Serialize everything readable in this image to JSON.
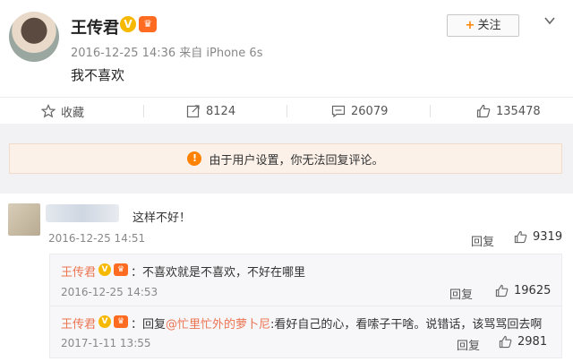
{
  "post": {
    "author": "王传君",
    "vip_badge": "V",
    "member_badge": "♛",
    "meta": "2016-12-25 14:36 来自 iPhone 6s",
    "content": "我不喜欢",
    "follow_label": "关注",
    "follow_plus": "+"
  },
  "actions": {
    "favorite_label": "收藏",
    "forward_count": "8124",
    "comment_count": "26079",
    "like_count": "135478"
  },
  "notice": {
    "text": "由于用户设置，你无法回复评论。",
    "icon": "!"
  },
  "comment": {
    "text": "这样不好！",
    "time": "2016-12-25 14:51",
    "reply_label": "回复",
    "likes": "9319"
  },
  "replies": [
    {
      "author": "王传君",
      "text": "：不喜欢就是不喜欢，不好在哪里",
      "time": "2016-12-25 14:53",
      "reply_label": "回复",
      "likes": "19625"
    },
    {
      "author": "王传君",
      "prefix": "：回复",
      "mention": "@忙里忙外的萝卜尼",
      "text": ":看好自己的心，看嗦子干啥。说错话，该骂骂回去啊",
      "time": "2017-1-11 13:55",
      "reply_label": "回复",
      "likes": "2981"
    }
  ],
  "colors": {
    "accent": "#eb7350",
    "follow_plus": "#ff8200",
    "notice_bg": "#fbf1e8"
  }
}
